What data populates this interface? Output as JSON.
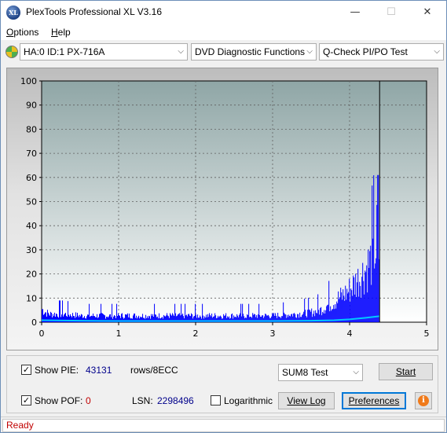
{
  "window": {
    "title": "PlexTools Professional XL V3.16",
    "app_icon_text": "XL",
    "minimize_glyph": "—",
    "maximize_glyph": "☐",
    "close_glyph": "✕"
  },
  "menu": {
    "options_first": "O",
    "options_rest": "ptions",
    "help_first": "H",
    "help_rest": "elp"
  },
  "toolbar": {
    "drive": "HA:0 ID:1  PX-716A",
    "function": "DVD Diagnostic Functions",
    "test": "Q-Check PI/PO Test",
    "arrow": "⌵"
  },
  "chart_data": {
    "type": "bar",
    "title": "",
    "xlabel": "",
    "ylabel": "",
    "xlim": [
      0,
      5
    ],
    "ylim": [
      0,
      100
    ],
    "x_ticks": [
      "0",
      "1",
      "2",
      "3",
      "4",
      "5"
    ],
    "y_ticks": [
      "0",
      "10",
      "20",
      "30",
      "40",
      "50",
      "60",
      "70",
      "80",
      "90",
      "100"
    ],
    "grid": true,
    "disc_end_x": 4.39,
    "colors": {
      "pie_bars": "#0000ff",
      "sum_line": "#00c8ff",
      "plot_bg_top": "#8fa6a6",
      "plot_bg_bottom": "#ffffff"
    },
    "series": [
      {
        "kind": "pie_envelope",
        "x": [
          0.0,
          0.05,
          0.1,
          0.2,
          0.3,
          0.5,
          0.8,
          1.0,
          1.5,
          2.0,
          2.5,
          3.0,
          3.3,
          3.5,
          3.6,
          3.7,
          3.8,
          3.9,
          4.0,
          4.1,
          4.2,
          4.25,
          4.3,
          4.32,
          4.34,
          4.36,
          4.38,
          4.39
        ],
        "values": [
          8,
          6,
          5,
          5,
          5,
          4,
          4,
          4,
          4,
          4,
          4,
          4,
          5,
          6,
          7,
          10,
          13,
          16,
          20,
          26,
          32,
          36,
          40,
          45,
          44,
          61,
          42,
          38
        ]
      },
      {
        "kind": "sum_line",
        "x": [
          0.0,
          0.5,
          1.0,
          2.0,
          3.0,
          3.5,
          3.8,
          4.0,
          4.2,
          4.39
        ],
        "values": [
          0.8,
          0.6,
          0.5,
          0.5,
          0.5,
          0.6,
          0.8,
          1.2,
          1.8,
          2.5
        ]
      }
    ]
  },
  "controls": {
    "show_pie_label": "Show PIE:",
    "pie_value": "43131",
    "rows_label": "rows/8ECC",
    "show_pof_label": "Show POF:",
    "pof_value": "0",
    "lsn_label": "LSN:",
    "lsn_value": "2298496",
    "logarithmic_label": "Logarithmic",
    "sum8_test": "SUM8 Test",
    "start_label": "Start",
    "view_log_label": "View Log",
    "preferences_label": "Preferences",
    "info_glyph": "i",
    "check_glyph": "✓"
  },
  "status": {
    "text": "Ready"
  }
}
